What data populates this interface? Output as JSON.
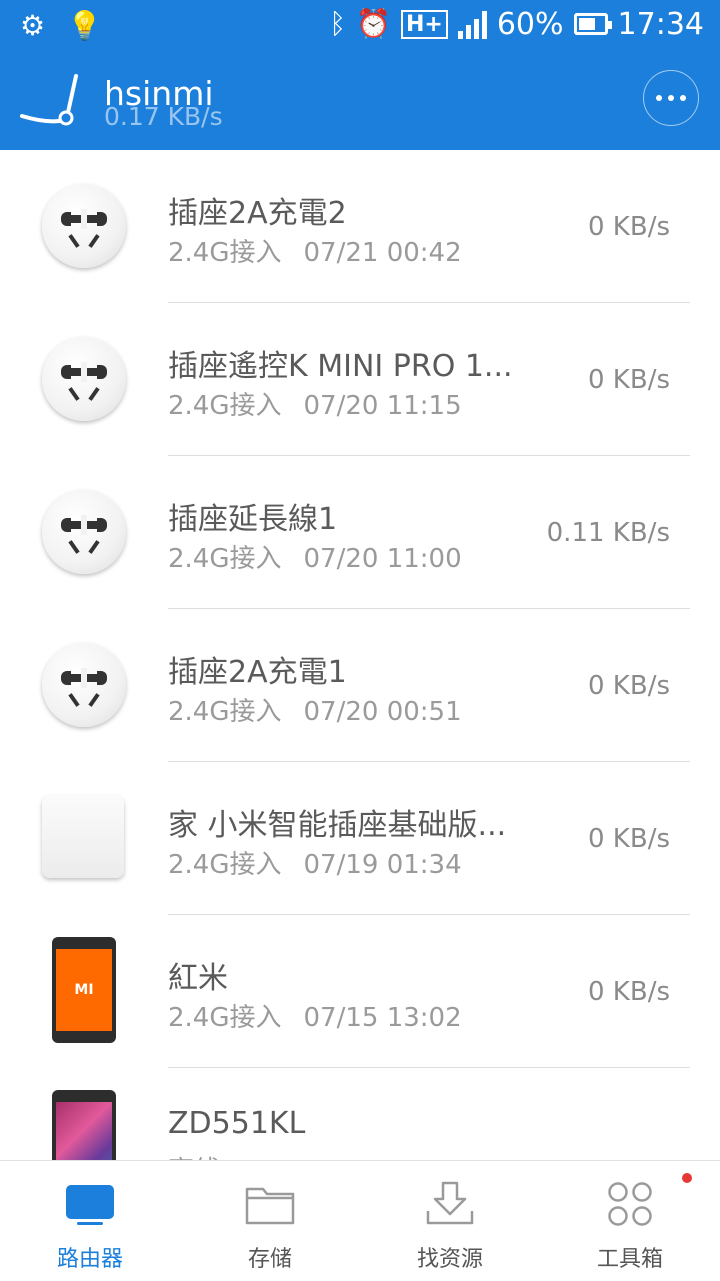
{
  "status_bar": {
    "battery_percent": "60%",
    "time": "17:34",
    "network": "H+"
  },
  "header": {
    "title": "hsinmi",
    "speed": "0.17 KB/s"
  },
  "devices": [
    {
      "name": "插座2A充電2",
      "band": "2.4G接入",
      "time": "07/21 00:42",
      "speed": "0 KB/s",
      "icon": "plug-icon"
    },
    {
      "name": "插座遙控K MINI PRO 1...",
      "band": "2.4G接入",
      "time": "07/20 11:15",
      "speed": "0 KB/s",
      "icon": "plug-icon"
    },
    {
      "name": "插座延長線1",
      "band": "2.4G接入",
      "time": "07/20 11:00",
      "speed": "0.11 KB/s",
      "icon": "plug-icon"
    },
    {
      "name": "插座2A充電1",
      "band": "2.4G接入",
      "time": "07/20 00:51",
      "speed": "0 KB/s",
      "icon": "plug-icon"
    },
    {
      "name": "家 小米智能插座基础版...",
      "band": "2.4G接入",
      "time": "07/19 01:34",
      "speed": "0 KB/s",
      "icon": "smart-socket-icon"
    },
    {
      "name": "紅米",
      "band": "2.4G接入",
      "time": "07/15 13:02",
      "speed": "0 KB/s",
      "icon": "phone-icon",
      "screen_label": "MI"
    },
    {
      "name": "ZD551KL",
      "band": "离线",
      "time": "",
      "speed": "",
      "icon": "phone-icon"
    }
  ],
  "tabs": [
    {
      "label": "路由器",
      "icon": "router-tv-icon",
      "active": true
    },
    {
      "label": "存储",
      "icon": "folder-icon",
      "active": false
    },
    {
      "label": "找资源",
      "icon": "download-icon",
      "active": false
    },
    {
      "label": "工具箱",
      "icon": "apps-icon",
      "active": false
    }
  ],
  "colors": {
    "accent": "#1b7fdb",
    "notification_dot": "#e53935"
  }
}
